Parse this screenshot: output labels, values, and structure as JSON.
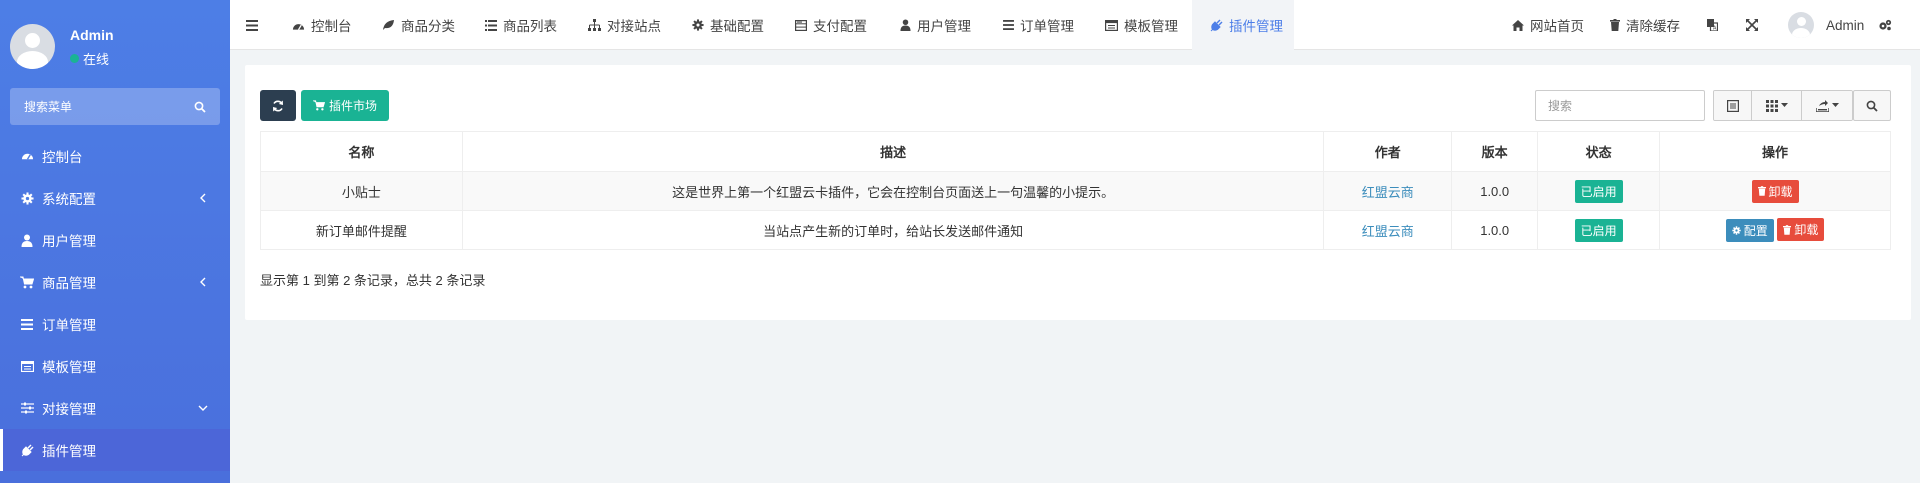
{
  "sidebar": {
    "user": {
      "name": "Admin",
      "status": "在线"
    },
    "search_label": "搜索菜单",
    "items": [
      {
        "label": "控制台",
        "icon": "dashboard-icon",
        "chevron": ""
      },
      {
        "label": "系统配置",
        "icon": "gear-icon",
        "chevron": "left"
      },
      {
        "label": "用户管理",
        "icon": "user-icon",
        "chevron": ""
      },
      {
        "label": "商品管理",
        "icon": "cart-icon",
        "chevron": "left"
      },
      {
        "label": "订单管理",
        "icon": "list-icon",
        "chevron": ""
      },
      {
        "label": "模板管理",
        "icon": "template-icon",
        "chevron": ""
      },
      {
        "label": "对接管理",
        "icon": "sliders-icon",
        "chevron": "down"
      },
      {
        "label": "插件管理",
        "icon": "plug-icon",
        "chevron": "",
        "active": true
      }
    ]
  },
  "topbar": {
    "menu_toggle": "menu-toggle-icon",
    "tabs": [
      {
        "label": "控制台",
        "icon": "dashboard-icon"
      },
      {
        "label": "商品分类",
        "icon": "leaf-icon"
      },
      {
        "label": "商品列表",
        "icon": "list-icon"
      },
      {
        "label": "对接站点",
        "icon": "sitemap-icon"
      },
      {
        "label": "基础配置",
        "icon": "gear-icon"
      },
      {
        "label": "支付配置",
        "icon": "server-icon"
      },
      {
        "label": "用户管理",
        "icon": "user-icon"
      },
      {
        "label": "订单管理",
        "icon": "bars-icon"
      },
      {
        "label": "模板管理",
        "icon": "template-icon"
      },
      {
        "label": "插件管理",
        "icon": "plug-icon",
        "active": true
      }
    ],
    "right": {
      "home_label": "网站首页",
      "cache_label": "清除缓存",
      "user_label": "Admin"
    }
  },
  "toolbar": {
    "market_label": "插件市场",
    "search_placeholder": "搜索"
  },
  "table": {
    "headers": [
      "名称",
      "描述",
      "作者",
      "版本",
      "状态",
      "操作"
    ],
    "rows": [
      {
        "name": "小贴士",
        "desc": "这是世界上第一个红盟云卡插件，它会在控制台页面送上一句温馨的小提示。",
        "author": "红盟云商",
        "version": "1.0.0",
        "status": "已启用",
        "config": "",
        "uninstall": "卸载"
      },
      {
        "name": "新订单邮件提醒",
        "desc": "当站点产生新的订单时，给站长发送邮件通知",
        "author": "红盟云商",
        "version": "1.0.0",
        "status": "已启用",
        "config": "配置",
        "uninstall": "卸载"
      }
    ]
  },
  "pager": {
    "text": "显示第 1 到第 2 条记录，总共 2 条记录"
  },
  "colors": {
    "sidebar": "#4d7ee6",
    "accent": "#4c7ee8",
    "success": "#1ab394",
    "danger": "#e74c3c",
    "info": "#3c8dbc",
    "dark": "#2c3e50"
  }
}
